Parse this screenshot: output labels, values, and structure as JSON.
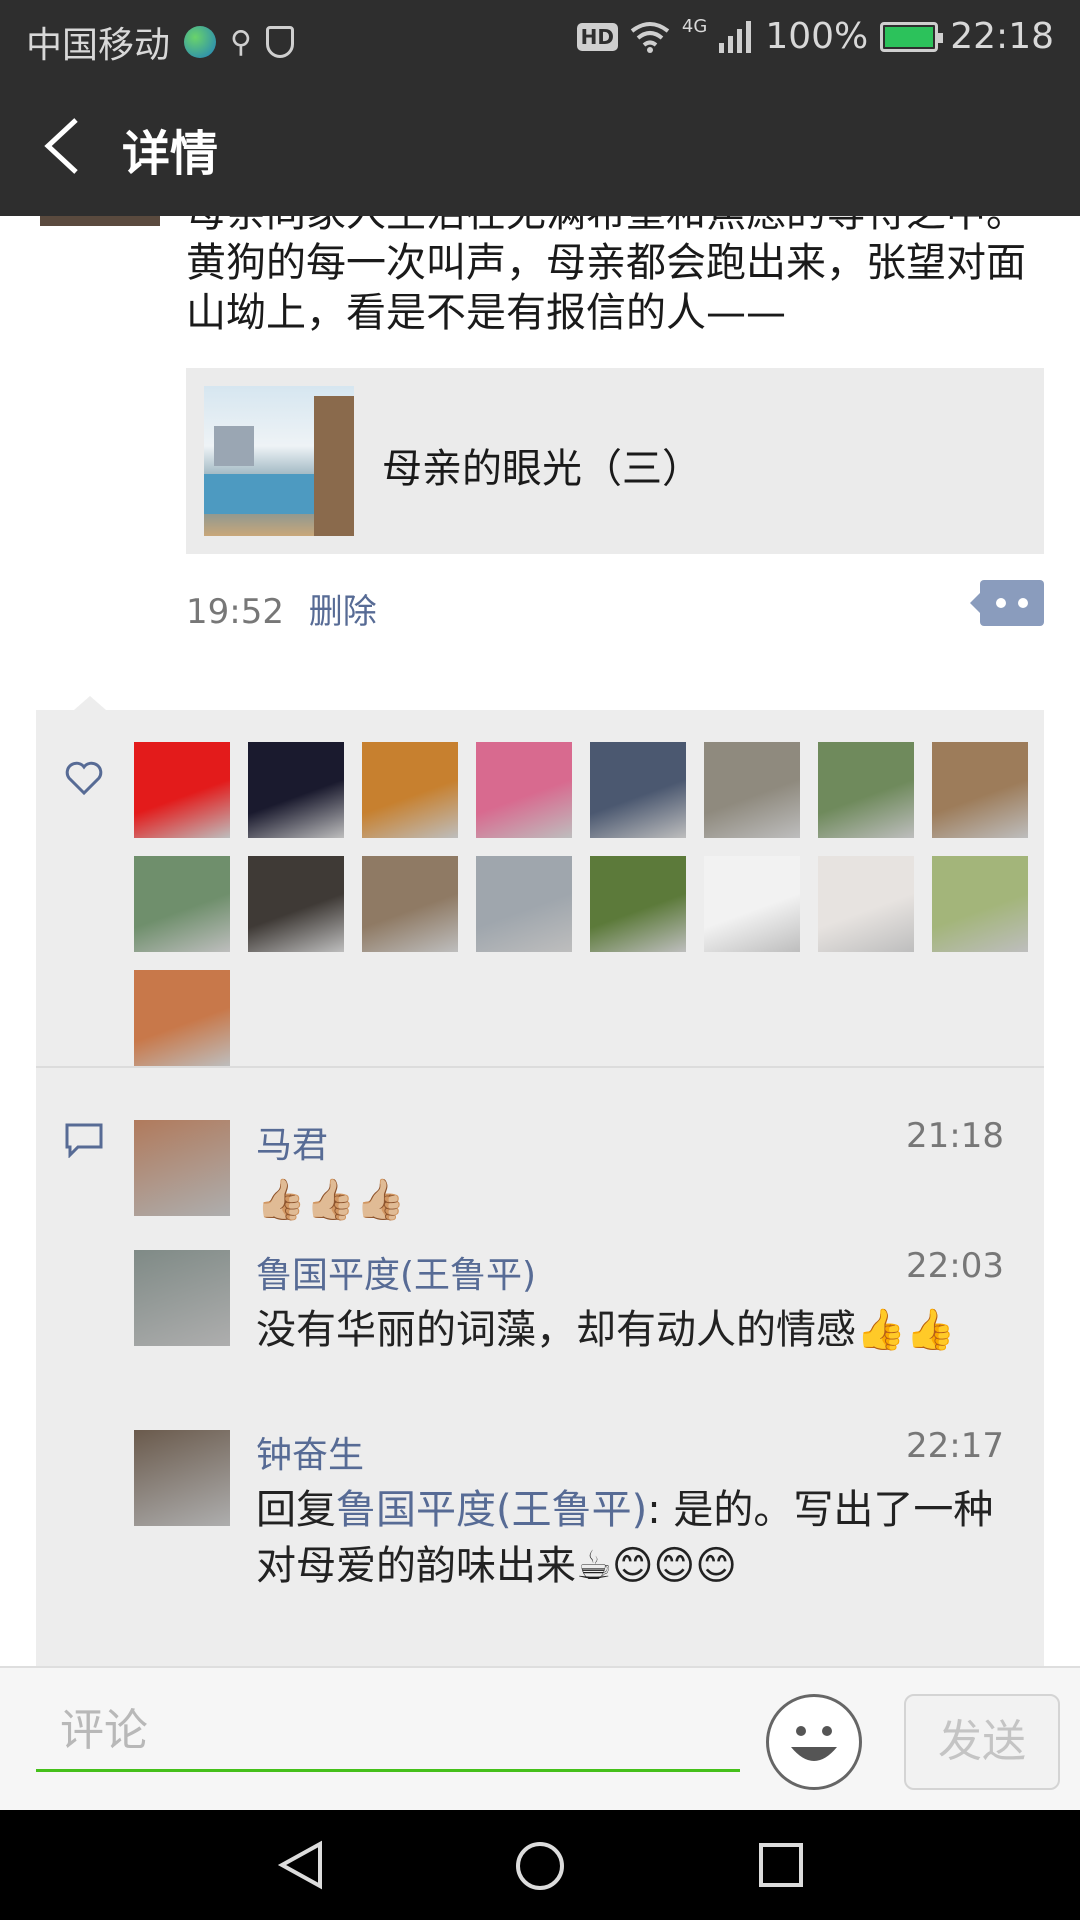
{
  "status_bar": {
    "carrier": "中国移动",
    "network_badge": "HD",
    "network_type": "4G",
    "battery_text": "100%",
    "battery_level": 1.0,
    "time": "22:18",
    "icons": [
      "globe-icon",
      "usb-icon",
      "shield-icon",
      "wifi-icon",
      "signal-icon",
      "battery-icon"
    ]
  },
  "title_bar": {
    "title": "详情",
    "back_icon": "chevron-left-icon"
  },
  "post": {
    "text": "母亲同家人生活在无满希望和焦虑的等待之中。黄狗的每一次叫声，母亲都会跑出来，张望对面山坳上，看是不是有报信的人——",
    "link_card": {
      "title": "母亲的眼光（三）"
    },
    "time": "19:52",
    "delete_label": "删除",
    "more_icon": "more-dots-icon"
  },
  "likes": {
    "icon": "heart-icon",
    "avatar_colors": [
      "#e31b1b",
      "#1a1a2e",
      "#c7802f",
      "#d86a8f",
      "#4b5870",
      "#8f8a7e",
      "#6f8a5c",
      "#9d7c5a",
      "#6f8f6c",
      "#3f3a36",
      "#8f7a64",
      "#9fa6ad",
      "#5c7a3a",
      "#f2f2f2",
      "#e7e3e0",
      "#a3b57a",
      "#c8784a"
    ]
  },
  "comments": {
    "icon": "comment-bubble-icon",
    "items": [
      {
        "name": "马君",
        "time": "21:18",
        "text": "👍🏼👍🏼👍🏼",
        "avatar_color": "#b07a5c"
      },
      {
        "name": "鲁国平度(王鲁平)",
        "time": "22:03",
        "text": "没有华丽的词藻，却有动人的情感👍👍",
        "avatar_color": "#7f8a86"
      },
      {
        "name": "钟奋生",
        "time": "22:17",
        "reply_prefix": "回复",
        "reply_to": "鲁国平度(王鲁平)",
        "text": ": 是的。写出了一种对母爱的韵味出来☕😊😊😊",
        "avatar_color": "#6a5a4c"
      }
    ]
  },
  "comment_bar": {
    "placeholder": "评论",
    "send_label": "发送",
    "emoji_icon": "smiley-icon"
  },
  "nav_bar": {
    "icons": [
      "nav-back-icon",
      "nav-home-icon",
      "nav-recents-icon"
    ]
  }
}
